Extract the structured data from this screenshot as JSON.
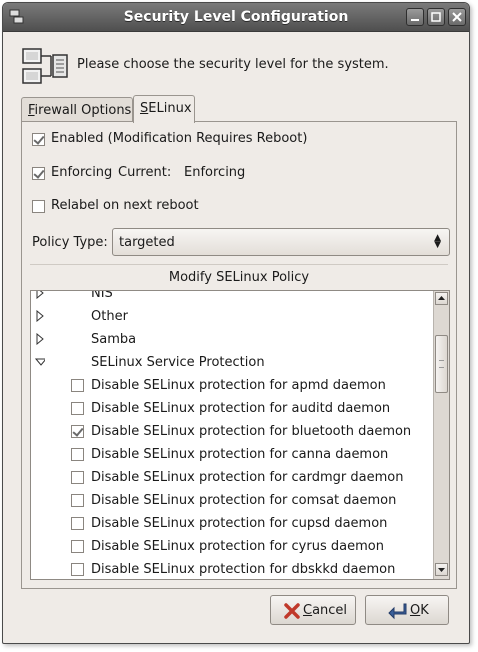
{
  "window": {
    "title": "Security Level Configuration",
    "controls": [
      "minimize",
      "maximize",
      "close"
    ]
  },
  "header": {
    "prompt": "Please choose the security level for the system."
  },
  "tabs": [
    {
      "label": "Firewall Options",
      "mnemonic": "F",
      "rest": "irewall Options",
      "active": false
    },
    {
      "label": "SELinux",
      "mnemonic": "S",
      "rest": "ELinux",
      "active": true
    }
  ],
  "selinux": {
    "enabled": {
      "label": "Enabled (Modification Requires Reboot)",
      "checked": true
    },
    "enforcing": {
      "label": "Enforcing",
      "current_label": "Current:",
      "current_value": "Enforcing",
      "checked": true
    },
    "relabel": {
      "label": "Relabel on next reboot",
      "checked": false
    },
    "policy_type": {
      "label": "Policy Type:",
      "value": "targeted"
    },
    "list_title": "Modify SELinux Policy",
    "tree": [
      {
        "type": "group",
        "label": "NIS",
        "expanded": false
      },
      {
        "type": "group",
        "label": "Other",
        "expanded": false
      },
      {
        "type": "group",
        "label": "Samba",
        "expanded": false
      },
      {
        "type": "group",
        "label": "SELinux Service Protection",
        "expanded": true
      },
      {
        "type": "item",
        "label": "Disable SELinux protection for apmd daemon",
        "checked": false
      },
      {
        "type": "item",
        "label": "Disable SELinux protection for auditd daemon",
        "checked": false
      },
      {
        "type": "item",
        "label": "Disable SELinux protection for bluetooth daemon",
        "checked": true
      },
      {
        "type": "item",
        "label": "Disable SELinux protection for canna daemon",
        "checked": false
      },
      {
        "type": "item",
        "label": "Disable SELinux protection for cardmgr daemon",
        "checked": false
      },
      {
        "type": "item",
        "label": "Disable SELinux protection for comsat daemon",
        "checked": false
      },
      {
        "type": "item",
        "label": "Disable SELinux protection for cupsd daemon",
        "checked": false
      },
      {
        "type": "item",
        "label": "Disable SELinux protection for cyrus daemon",
        "checked": false
      },
      {
        "type": "item",
        "label": "Disable SELinux protection for dbskkd daemon",
        "checked": false
      }
    ]
  },
  "buttons": {
    "cancel": {
      "label": "Cancel",
      "mnemonic": "C",
      "rest": "ancel",
      "icon": "cancel-x-icon"
    },
    "ok": {
      "label": "OK",
      "mnemonic": "O",
      "rest": "K",
      "icon": "ok-arrow-icon"
    }
  },
  "colors": {
    "titlebar": "#5f5f5f",
    "window_bg": "#efebe7",
    "cancel_icon": "#c0392b",
    "ok_icon": "#3a5f9a"
  }
}
